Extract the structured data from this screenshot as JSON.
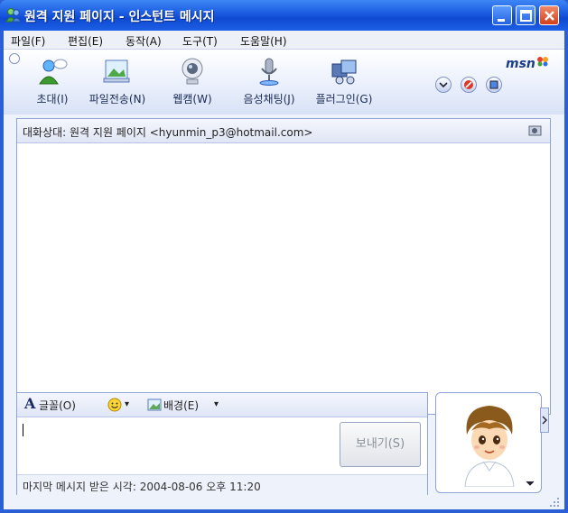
{
  "window": {
    "title": "원격 지원 페이지 - 인스턴트 메시지"
  },
  "menu": [
    {
      "label": "파일(F)"
    },
    {
      "label": "편집(E)"
    },
    {
      "label": "동작(A)"
    },
    {
      "label": "도구(T)"
    },
    {
      "label": "도움말(H)"
    }
  ],
  "toolbar": {
    "items": [
      {
        "label": "초대(I)",
        "icon": "invite-user-icon"
      },
      {
        "label": "파일전송(N)",
        "icon": "send-file-icon"
      },
      {
        "label": "웹캠(W)",
        "icon": "webcam-icon"
      },
      {
        "label": "음성채팅(J)",
        "icon": "microphone-icon"
      },
      {
        "label": "플러그인(G)",
        "icon": "plugin-icon"
      }
    ],
    "brand": "msn"
  },
  "conversation": {
    "label": "대화상대: 원격 지원 페이지 <hyunmin_p3@hotmail.com>",
    "messages": []
  },
  "compose": {
    "font_label": "글꼴(O)",
    "emoticon_label": "▾",
    "background_label": "배경(E)",
    "value": "",
    "send_label": "보내기(S)"
  },
  "status": {
    "text": "마지막 메시지 받은 시각: 2004-08-06 오후 11:20"
  },
  "colors": {
    "titlebar": "#1a5ae0",
    "frame": "#2a5fd6",
    "panel_border": "#8fa4d4"
  }
}
